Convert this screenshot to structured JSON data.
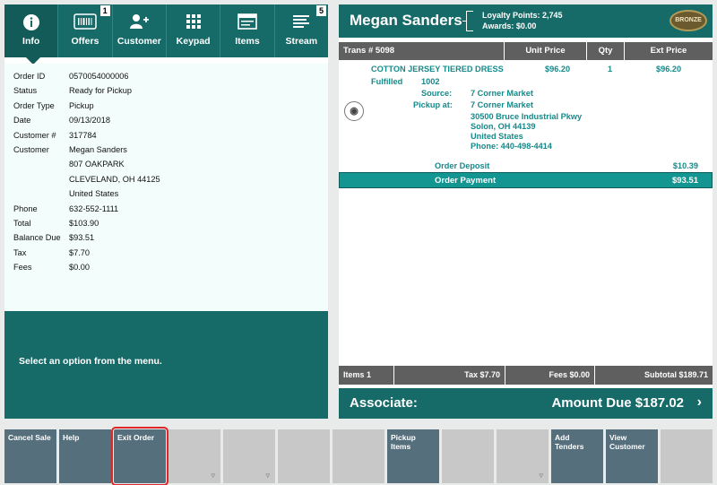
{
  "toolbar": {
    "items": [
      {
        "label": "Info",
        "icon": "info-icon",
        "count": ""
      },
      {
        "label": "Offers",
        "icon": "barcode-icon",
        "count": "1"
      },
      {
        "label": "Customer",
        "icon": "add-person-icon",
        "count": ""
      },
      {
        "label": "Keypad",
        "icon": "keypad-icon",
        "count": ""
      },
      {
        "label": "Items",
        "icon": "items-icon",
        "count": ""
      },
      {
        "label": "Stream",
        "icon": "stream-icon",
        "count": "5"
      }
    ]
  },
  "order": {
    "fields": [
      {
        "k": "Order ID",
        "v": [
          "0570054000006"
        ]
      },
      {
        "k": "Status",
        "v": [
          "Ready for Pickup"
        ]
      },
      {
        "k": "Order Type",
        "v": [
          "Pickup"
        ]
      },
      {
        "k": "Date",
        "v": [
          "09/13/2018"
        ]
      },
      {
        "k": "Customer #",
        "v": [
          "317784"
        ]
      },
      {
        "k": "Customer",
        "v": [
          "Megan Sanders",
          "807 OAKPARK",
          "CLEVELAND, OH 44125",
          "United States"
        ]
      },
      {
        "k": "Phone",
        "v": [
          "632-552-1111"
        ]
      },
      {
        "k": "Total",
        "v": [
          "$103.90"
        ]
      },
      {
        "k": "Balance Due",
        "v": [
          "$93.51"
        ]
      },
      {
        "k": "Tax",
        "v": [
          "$7.70"
        ]
      },
      {
        "k": "Fees",
        "v": [
          "$0.00"
        ]
      }
    ]
  },
  "message": "Select an option from the menu.",
  "customer": {
    "name": "Megan Sanders",
    "loyalty": "Loyalty Points:  2,745",
    "awards": "Awards:  $0.00",
    "tier": "BRONZE"
  },
  "trans": {
    "header": [
      "Trans # 5098",
      "Unit Price",
      "Qty",
      "Ext Price"
    ],
    "item": {
      "name": "COTTON JERSEY TIERED DRESS",
      "unit_price": "$96.20",
      "qty": "1",
      "ext_price": "$96.20",
      "status": "Fulfilled",
      "status_qty": "1002",
      "source_label": "Source:",
      "source": "7 Corner Market",
      "pickup_label": "Pickup at:",
      "pickup": "7 Corner Market",
      "addr1": "30500 Bruce Industrial Pkwy",
      "addr2": "Solon, OH 44139",
      "addr3": "United States",
      "phone": "Phone: 440-498-4414"
    },
    "deposit_label": "Order Deposit",
    "deposit": "$10.39",
    "payment_label": "Order Payment",
    "payment": "$93.51"
  },
  "totals": {
    "items": "Items 1",
    "tax": "Tax $7.70",
    "fees": "Fees $0.00",
    "subtotal": "Subtotal $189.71"
  },
  "amount": {
    "associate": "Associate:",
    "due": "Amount Due  $187.02",
    "chevron": "›"
  },
  "functions": [
    {
      "label": "Cancel Sale",
      "enabled": true
    },
    {
      "label": "Help",
      "enabled": true
    },
    {
      "label": "Exit Order",
      "enabled": true,
      "selected": true
    },
    {
      "label": "",
      "enabled": false,
      "mark": "▿"
    },
    {
      "label": "",
      "enabled": false,
      "mark": "▿"
    },
    {
      "label": "",
      "enabled": false
    },
    {
      "label": "",
      "enabled": false
    },
    {
      "label": "Pickup Items",
      "enabled": true
    },
    {
      "label": "",
      "enabled": false
    },
    {
      "label": "",
      "enabled": false,
      "mark": "▿"
    },
    {
      "label": "Add Tenders",
      "enabled": true
    },
    {
      "label": "View Customer",
      "enabled": true
    },
    {
      "label": "",
      "enabled": false
    }
  ],
  "colors": {
    "brand": "#166b69",
    "accent": "#139592",
    "item_text": "#17898a",
    "header_gray": "#5f5f5f",
    "button_active": "#566f7d",
    "button_disabled": "#c8c8c8",
    "selection": "#e02626"
  }
}
